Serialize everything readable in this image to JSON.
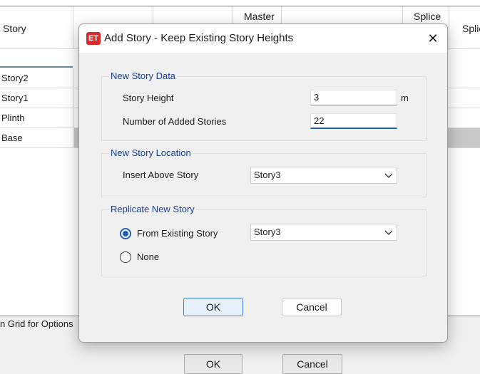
{
  "background": {
    "headers": {
      "story": "Story",
      "master": "Master",
      "splice": "Splice",
      "splice_cut": "Splic"
    },
    "rows": [
      "Story2",
      "Story1",
      "Plinth",
      "Base"
    ],
    "status_text": "n Grid for Options",
    "ok_label": "OK",
    "cancel_label": "Cancel"
  },
  "dialog": {
    "app_icon_text": "ET",
    "title": "Add Story - Keep Existing Story Heights",
    "close_symbol": "✕",
    "new_story_data": {
      "group_title": "New Story Data",
      "story_height_label": "Story Height",
      "story_height_value": "3",
      "story_height_unit": "m",
      "added_stories_label": "Number of Added Stories",
      "added_stories_value": "22"
    },
    "new_story_location": {
      "group_title": "New Story Location",
      "insert_above_label": "Insert Above Story",
      "insert_above_value": "Story3"
    },
    "replicate": {
      "group_title": "Replicate New Story",
      "from_existing_label": "From Existing Story",
      "from_existing_value": "Story3",
      "none_label": "None",
      "selected": "from_existing"
    },
    "ok_label": "OK",
    "cancel_label": "Cancel"
  },
  "colors": {
    "accent": "#1f5fbf",
    "group_title": "#1b3c8f",
    "app_icon": "#d9292b"
  }
}
